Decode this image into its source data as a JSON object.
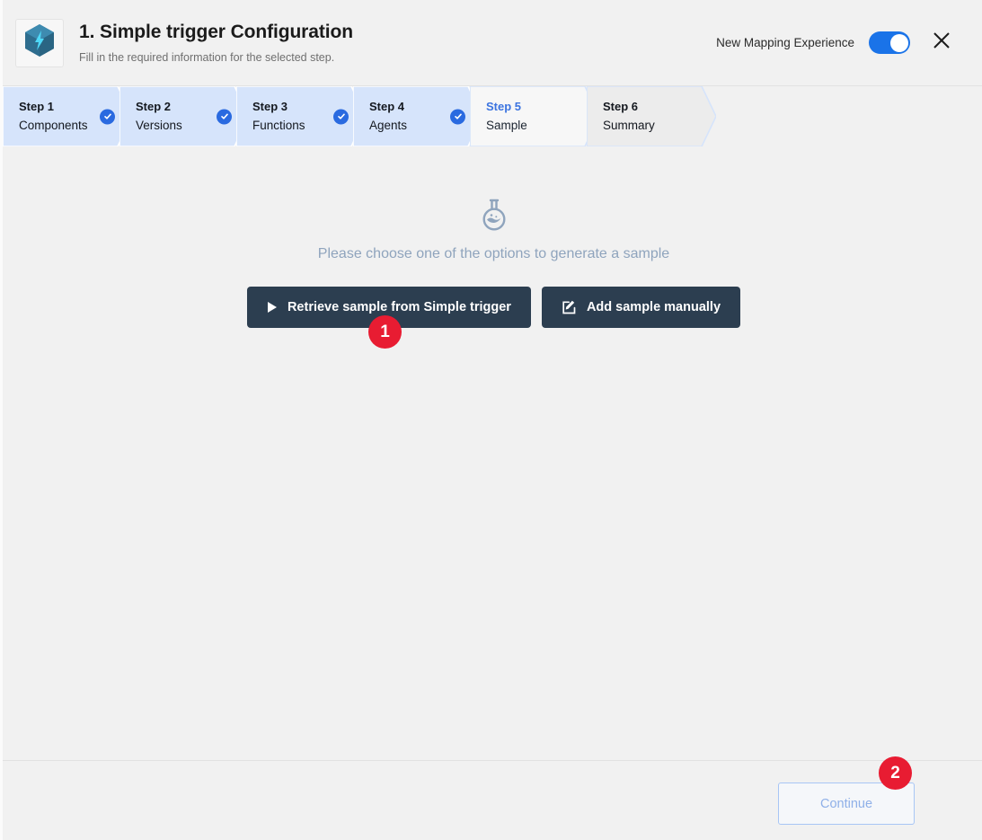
{
  "header": {
    "app_icon": "hexagon-lightning-icon",
    "title": "1. Simple trigger Configuration",
    "subtitle": "Fill in the required information for the selected step.",
    "toggle_label": "New Mapping Experience",
    "toggle_state": "on",
    "close_icon": "close-icon",
    "accent_color": "#1a73e8"
  },
  "steps": [
    {
      "num": "Step 1",
      "name": "Components",
      "state": "completed",
      "badge_icon": "check-icon"
    },
    {
      "num": "Step 2",
      "name": "Versions",
      "state": "completed",
      "badge_icon": "check-icon"
    },
    {
      "num": "Step 3",
      "name": "Functions",
      "state": "completed",
      "badge_icon": "check-icon"
    },
    {
      "num": "Step 4",
      "name": "Agents",
      "state": "completed",
      "badge_icon": "check-icon"
    },
    {
      "num": "Step 5",
      "name": "Sample",
      "state": "active",
      "badge_icon": ""
    },
    {
      "num": "Step 6",
      "name": "Summary",
      "state": "upcoming",
      "badge_icon": ""
    }
  ],
  "main": {
    "empty_icon": "flask-icon",
    "empty_message": "Please choose one of the options to generate a sample",
    "buttons": [
      {
        "icon": "play-icon",
        "label": "Retrieve sample from  Simple trigger"
      },
      {
        "icon": "edit-square-icon",
        "label": "Add sample manually"
      }
    ]
  },
  "footer": {
    "continue_label": "Continue",
    "continue_state": "disabled"
  },
  "annotations": [
    {
      "number": "1",
      "color": "#e81c32"
    },
    {
      "number": "2",
      "color": "#e81c32"
    }
  ]
}
